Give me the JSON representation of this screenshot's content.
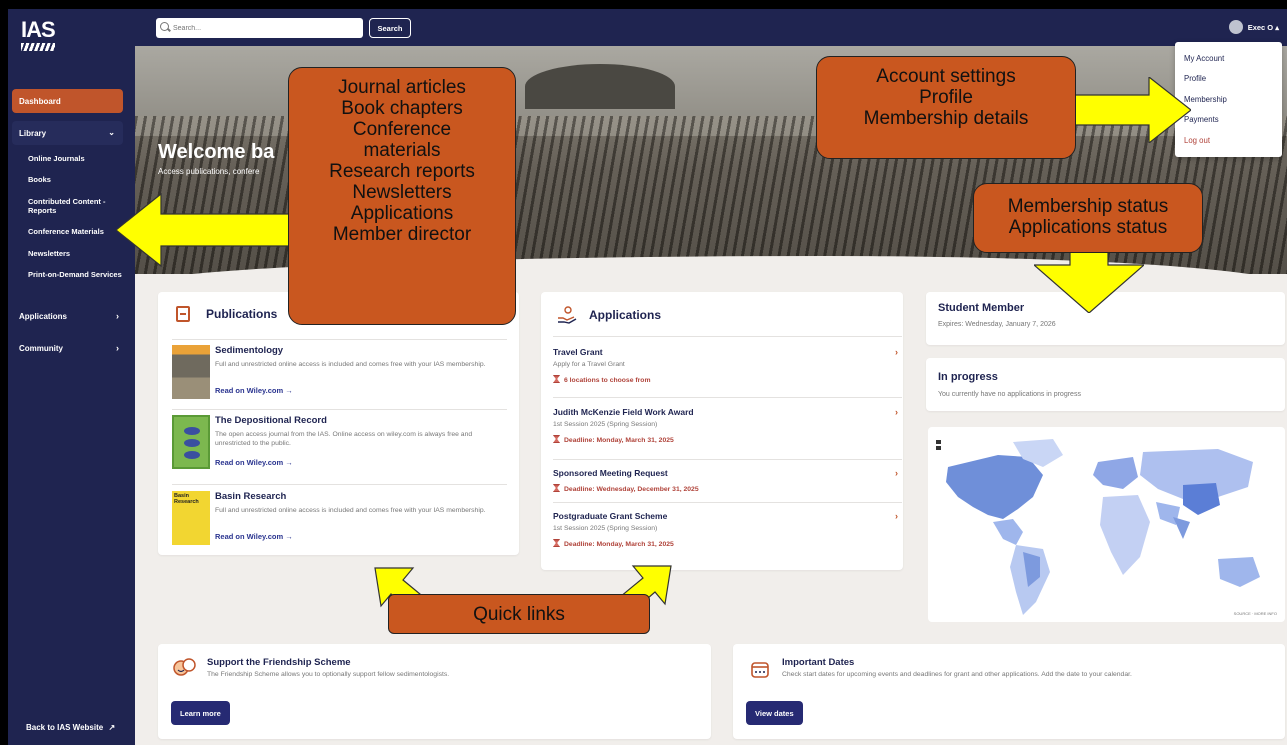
{
  "sidebar": {
    "logo": "IAS",
    "dashboard": "Dashboard",
    "library": "Library",
    "library_items": [
      "Online Journals",
      "Books",
      "Contributed Content - Reports",
      "Conference Materials",
      "Newsletters",
      "Print-on-Demand Services"
    ],
    "applications": "Applications",
    "community": "Community",
    "back_link": "Back to IAS Website"
  },
  "topbar": {
    "search_placeholder": "Search...",
    "search_button": "Search",
    "user": "Exec O"
  },
  "hero": {
    "title": "Welcome ba",
    "subtitle": "Access publications, confere"
  },
  "publications": {
    "title": "Publications",
    "items": [
      {
        "name": "Sedimentology",
        "desc": "Full and unrestricted online access is included and comes free with your IAS membership.",
        "link": "Read on Wiley.com"
      },
      {
        "name": "The Depositional Record",
        "desc": "The open access journal from the IAS. Online access on wiley.com is always free and unrestricted to the public.",
        "link": "Read on Wiley.com"
      },
      {
        "name": "Basin Research",
        "desc": "Full and unrestricted online access is included and comes free with your IAS membership.",
        "link": "Read on Wiley.com"
      }
    ],
    "thumb_label": "Basin Research"
  },
  "applications": {
    "title": "Applications",
    "items": [
      {
        "name": "Travel Grant",
        "sub": "Apply for a Travel Grant",
        "deadline": "6 locations to choose from"
      },
      {
        "name": "Judith McKenzie Field Work Award",
        "sub": "1st Session 2025 (Spring Session)",
        "deadline": "Deadline: Monday, March 31, 2025"
      },
      {
        "name": "Sponsored Meeting Request",
        "sub": "",
        "deadline": "Deadline: Wednesday, December 31, 2025"
      },
      {
        "name": "Postgraduate Grant Scheme",
        "sub": "1st Session 2025 (Spring Session)",
        "deadline": "Deadline: Monday, March 31, 2025"
      }
    ]
  },
  "membership": {
    "title": "Student Member",
    "expires": "Expires: Wednesday, January 7, 2026"
  },
  "progress": {
    "title": "In progress",
    "text": "You currently have no applications in progress"
  },
  "map": {
    "source": "SOURCE · MORE INFO"
  },
  "friendship": {
    "title": "Support the Friendship Scheme",
    "desc": "The Friendship Scheme allows you to optionally support fellow sedimentologists.",
    "button": "Learn more"
  },
  "dates": {
    "title": "Important Dates",
    "desc": "Check start dates for upcoming events and deadlines for grant and other applications. Add the date to your calendar.",
    "button": "View dates"
  },
  "dropdown": {
    "items": [
      "My Account",
      "Profile",
      "Membership",
      "Payments",
      "Log out"
    ]
  },
  "annotations": {
    "library_callout": [
      "Journal articles",
      "Book chapters",
      "Conference",
      "materials",
      "Research reports",
      "Newsletters",
      "Applications",
      "Member director"
    ],
    "account_callout": [
      "Account settings",
      "Profile",
      "Membership details"
    ],
    "status_callout": [
      "Membership status",
      "Applications status"
    ],
    "quick_links": "Quick links"
  },
  "colors": {
    "navy": "#1f2450",
    "accent": "#c0552b",
    "callout": "#c9571f",
    "arrow": "#ffff00",
    "deadline": "#b0433a"
  }
}
